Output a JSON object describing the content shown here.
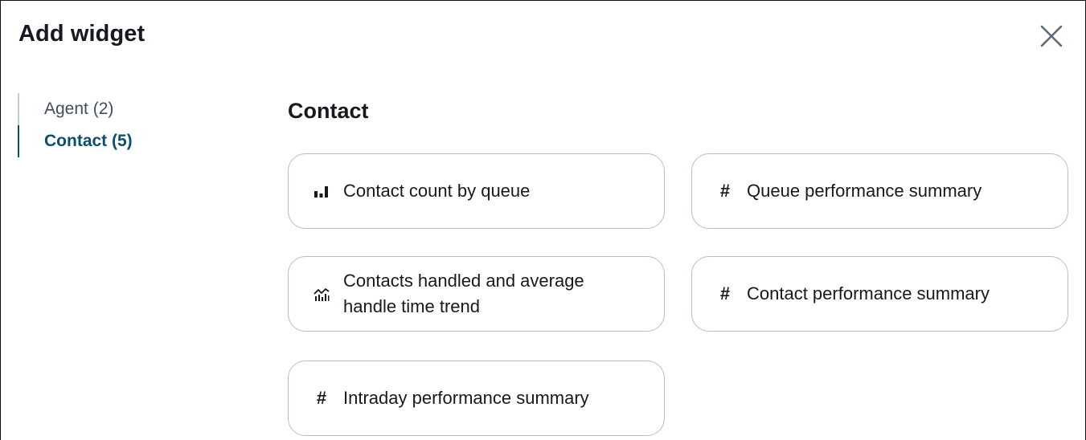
{
  "dialog": {
    "title": "Add widget",
    "close_icon": "close-icon"
  },
  "sidebar": {
    "items": [
      {
        "label": "Agent (2)",
        "active": false
      },
      {
        "label": "Contact (5)",
        "active": true
      }
    ]
  },
  "main": {
    "section_title": "Contact",
    "widgets": [
      {
        "label": "Contact count by queue",
        "icon": "bar-chart-icon"
      },
      {
        "label": "Queue performance summary",
        "icon": "hash-icon"
      },
      {
        "label": "Contacts handled and average handle time trend",
        "icon": "trend-chart-icon"
      },
      {
        "label": "Contact performance summary",
        "icon": "hash-icon"
      },
      {
        "label": "Intraday performance summary",
        "icon": "hash-icon"
      }
    ]
  },
  "colors": {
    "accent": "#0d4f6a",
    "text": "#16191f",
    "muted_text": "#414d5c",
    "card_border": "#b6bec9",
    "inactive_rail": "#c5cbd1"
  }
}
